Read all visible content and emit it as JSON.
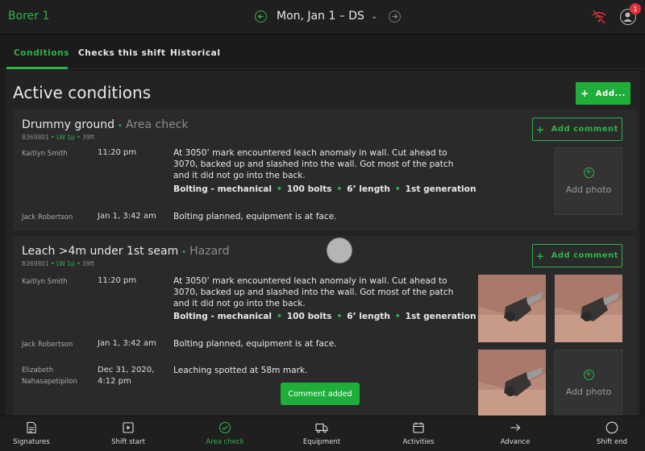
{
  "header": {
    "brand": "Borer 1",
    "date": "Mon, Jan 1 – DS",
    "notification_count": "1"
  },
  "tabs": [
    {
      "label": "Conditions",
      "active": true
    },
    {
      "label": "Checks this shift",
      "active": false
    },
    {
      "label": "Historical",
      "active": false
    }
  ],
  "main": {
    "title": "Active conditions",
    "add_label": "Add..."
  },
  "cards": [
    {
      "title": "Drummy ground",
      "type": "Area check",
      "meta": {
        "id": "B369801",
        "lw": "LW 1p",
        "ft": "39ft"
      },
      "comment_label": "Add comment",
      "entries": [
        {
          "author": "Kaitlyn Smith",
          "time": "11:20 pm",
          "text": "At 3050’ mark encountered leach anomaly in wall. Cut ahead to 3070, backed up and slashed into the wall. Got most of the patch and it did not go into the back.",
          "tags": [
            "Bolting - mechanical",
            "100 bolts",
            "6’ length",
            "1st generation"
          ]
        },
        {
          "author": "Jack Robertson",
          "time": "Jan 1, 3:42 am",
          "text": "Bolting planned, equipment is at face."
        }
      ],
      "photo_label": "Add photo"
    },
    {
      "title": "Leach >4m under 1st seam",
      "type": "Hazard",
      "meta": {
        "id": "B369801",
        "lw": "LW 1p",
        "ft": "39ft"
      },
      "comment_label": "Add comment",
      "entries": [
        {
          "author": "Kaitlyn Smith",
          "time": "11:20 pm",
          "text": "At 3050’ mark encountered leach anomaly in wall. Cut ahead to 3070, backed up and slashed into the wall. Got most of the patch and it did not go into the back.",
          "tags": [
            "Bolting - mechanical",
            "100 bolts",
            "6’ length",
            "1st generation"
          ]
        },
        {
          "author": "Jack Robertson",
          "time": "Jan 1, 3:42 am",
          "text": "Bolting planned, equipment is at face."
        },
        {
          "author": "Elizabeth Nahasapetipilon",
          "time": "Dec 31, 2020, 4:12 pm",
          "text": "Leaching spotted at 58m mark."
        }
      ],
      "photo_label": "Add photo"
    }
  ],
  "toast": "Comment added",
  "bottom_nav": [
    {
      "label": "Signatures",
      "icon": "document-icon"
    },
    {
      "label": "Shift start",
      "icon": "play-icon"
    },
    {
      "label": "Area check",
      "icon": "check-circle-icon",
      "active": true
    },
    {
      "label": "Equipment",
      "icon": "truck-icon"
    },
    {
      "label": "Activities",
      "icon": "calendar-icon"
    },
    {
      "label": "Advance",
      "icon": "arrow-right-icon"
    },
    {
      "label": "Shift end",
      "icon": "circle-icon"
    }
  ],
  "colors": {
    "accent": "#2fb24a",
    "badge": "#e0303a",
    "background": "#1b1b1b",
    "card": "#2a2a2a"
  }
}
